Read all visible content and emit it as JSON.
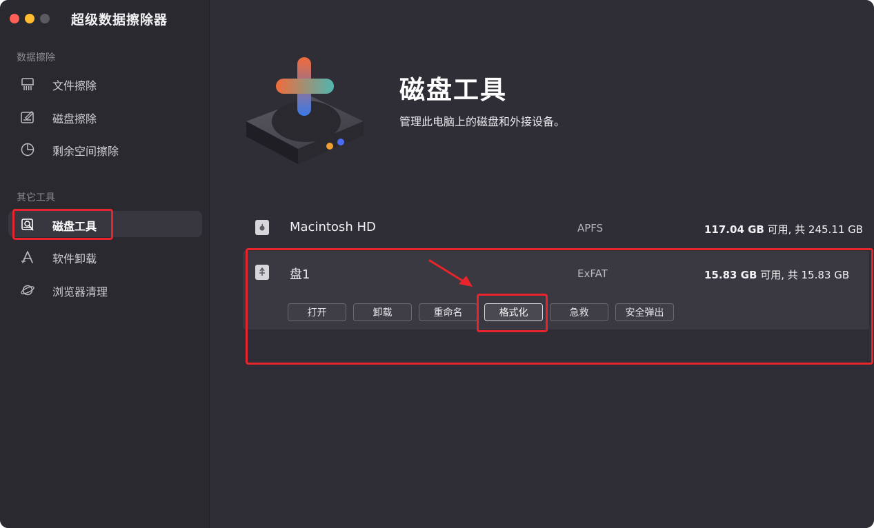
{
  "app": {
    "title": "超级数据擦除器"
  },
  "sidebar": {
    "sections": [
      {
        "title": "数据擦除",
        "items": [
          {
            "label": "文件擦除",
            "icon": "shredder-icon"
          },
          {
            "label": "磁盘擦除",
            "icon": "disk-erase-icon"
          },
          {
            "label": "剩余空间擦除",
            "icon": "pie-chart-icon"
          }
        ]
      },
      {
        "title": "其它工具",
        "items": [
          {
            "label": "磁盘工具",
            "icon": "disk-tool-icon",
            "active": true
          },
          {
            "label": "软件卸载",
            "icon": "app-uninstall-icon"
          },
          {
            "label": "浏览器清理",
            "icon": "planet-icon"
          }
        ]
      }
    ]
  },
  "hero": {
    "title": "磁盘工具",
    "subtitle": "管理此电脑上的磁盘和外接设备。"
  },
  "disks": [
    {
      "name": "Macintosh HD",
      "fs": "APFS",
      "available": "117.04 GB",
      "capacity_text": " 可用, 共 245.11 GB",
      "icon": "apple-disk-icon"
    },
    {
      "name": "盘1",
      "fs": "ExFAT",
      "available": "15.83 GB",
      "capacity_text": " 可用, 共 15.83 GB",
      "icon": "usb-disk-icon"
    }
  ],
  "actions": [
    "打开",
    "卸载",
    "重命名",
    "格式化",
    "急救",
    "安全弹出"
  ],
  "colors": {
    "highlight": "#e8242c",
    "accent_orange": "#f26b3a",
    "accent_blue": "#3b7ae8"
  }
}
